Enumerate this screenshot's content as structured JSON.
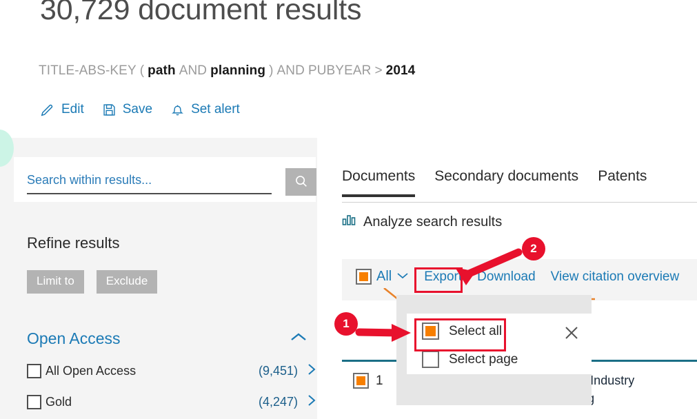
{
  "header": {
    "results_title": "30,729 document results",
    "query": {
      "field1": "TITLE-ABS-KEY",
      "open_paren": "(",
      "term1": "path",
      "op1": "AND",
      "term2": "planning",
      "close_paren": ")",
      "op2": "AND",
      "field2": "PUBYEAR",
      "comparator": ">",
      "value": "2014"
    },
    "actions": [
      {
        "label": "Edit",
        "icon": "pencil-icon"
      },
      {
        "label": "Save",
        "icon": "floppy-disk-icon"
      },
      {
        "label": "Set alert",
        "icon": "bell-icon"
      }
    ]
  },
  "sidebar": {
    "search_within": {
      "placeholder": "Search within results...",
      "value": "",
      "button_icon": "search-icon"
    },
    "refine_title": "Refine results",
    "limit_to_label": "Limit to",
    "exclude_label": "Exclude",
    "facet": {
      "title": "Open Access",
      "collapse_icon": "chevron-up-icon",
      "rows": [
        {
          "label": "All Open Access",
          "count": "(9,451)",
          "checked": false
        },
        {
          "label": "Gold",
          "count": "(4,247)",
          "checked": false
        }
      ]
    }
  },
  "main": {
    "tabs": [
      {
        "label": "Documents",
        "active": true
      },
      {
        "label": "Secondary documents",
        "active": false
      },
      {
        "label": "Patents",
        "active": false
      }
    ],
    "analyze_link": {
      "label": "Analyze search results",
      "icon": "bar-chart-icon"
    },
    "toolbar": {
      "all_label": "All",
      "all_checked": true,
      "all_chevron_icon": "chevron-down-icon",
      "links": [
        "Export",
        "Download",
        "View citation overview"
      ]
    },
    "dropdown": {
      "items": [
        {
          "label": "Select all",
          "checked": true
        },
        {
          "label": "Select page",
          "checked": false
        }
      ],
      "close_icon": "close-icon"
    },
    "results": [
      {
        "number": "1",
        "checked": true,
        "title": "Intelligent Path Planning for Health Industry Development Based on Data Mining"
      }
    ]
  },
  "annotations": {
    "callouts": [
      {
        "number": "1",
        "target": "select-all-menu-item"
      },
      {
        "number": "2",
        "target": "export-link"
      }
    ],
    "highlight_color": "#e8112d",
    "accent_orange": "#f77f00",
    "link_blue": "#1b7ab5"
  }
}
